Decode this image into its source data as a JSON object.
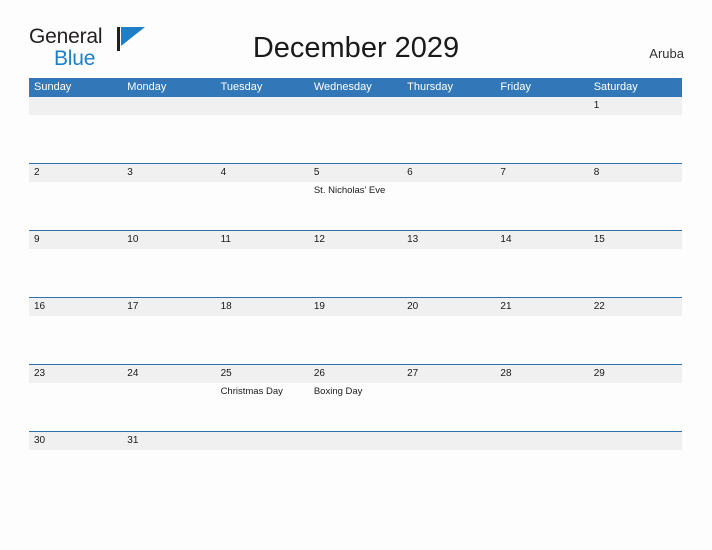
{
  "brand": {
    "word_general": "General",
    "word_blue": "Blue",
    "flag_icon": "blue-flag-icon",
    "accent_color": "#1f7fc4"
  },
  "header": {
    "title": "December 2029",
    "locale": "Aruba"
  },
  "theme": {
    "header_blue": "#3278b8",
    "row_line_blue": "#2f6fad",
    "number_band_gray": "#f0f0f0",
    "page_background": "#fdfdfd",
    "text_dark": "#1a1a1a"
  },
  "calendar": {
    "month": "December",
    "year": "2029",
    "weekdays": [
      "Sunday",
      "Monday",
      "Tuesday",
      "Wednesday",
      "Thursday",
      "Friday",
      "Saturday"
    ],
    "weeks": [
      {
        "days": [
          {
            "number": "",
            "events": []
          },
          {
            "number": "",
            "events": []
          },
          {
            "number": "",
            "events": []
          },
          {
            "number": "",
            "events": []
          },
          {
            "number": "",
            "events": []
          },
          {
            "number": "",
            "events": []
          },
          {
            "number": "1",
            "events": []
          }
        ]
      },
      {
        "days": [
          {
            "number": "2",
            "events": []
          },
          {
            "number": "3",
            "events": []
          },
          {
            "number": "4",
            "events": []
          },
          {
            "number": "5",
            "events": [
              "St. Nicholas’ Eve"
            ]
          },
          {
            "number": "6",
            "events": []
          },
          {
            "number": "7",
            "events": []
          },
          {
            "number": "8",
            "events": []
          }
        ]
      },
      {
        "days": [
          {
            "number": "9",
            "events": []
          },
          {
            "number": "10",
            "events": []
          },
          {
            "number": "11",
            "events": []
          },
          {
            "number": "12",
            "events": []
          },
          {
            "number": "13",
            "events": []
          },
          {
            "number": "14",
            "events": []
          },
          {
            "number": "15",
            "events": []
          }
        ]
      },
      {
        "days": [
          {
            "number": "16",
            "events": []
          },
          {
            "number": "17",
            "events": []
          },
          {
            "number": "18",
            "events": []
          },
          {
            "number": "19",
            "events": []
          },
          {
            "number": "20",
            "events": []
          },
          {
            "number": "21",
            "events": []
          },
          {
            "number": "22",
            "events": []
          }
        ]
      },
      {
        "days": [
          {
            "number": "23",
            "events": []
          },
          {
            "number": "24",
            "events": []
          },
          {
            "number": "25",
            "events": [
              "Christmas Day"
            ]
          },
          {
            "number": "26",
            "events": [
              "Boxing Day"
            ]
          },
          {
            "number": "27",
            "events": []
          },
          {
            "number": "28",
            "events": []
          },
          {
            "number": "29",
            "events": []
          }
        ]
      },
      {
        "days": [
          {
            "number": "30",
            "events": []
          },
          {
            "number": "31",
            "events": []
          },
          {
            "number": "",
            "events": []
          },
          {
            "number": "",
            "events": []
          },
          {
            "number": "",
            "events": []
          },
          {
            "number": "",
            "events": []
          },
          {
            "number": "",
            "events": []
          }
        ]
      }
    ]
  }
}
